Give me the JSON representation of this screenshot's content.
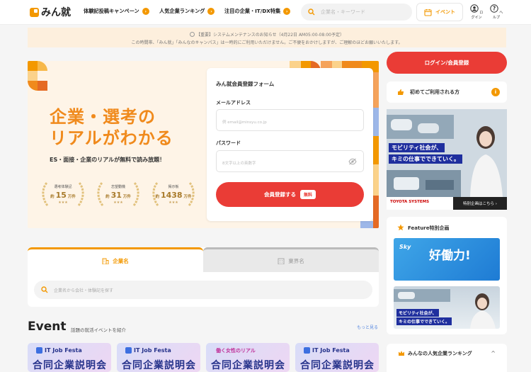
{
  "header": {
    "logo": "みん就",
    "nav": [
      {
        "label": "体験記投稿キャンペーン"
      },
      {
        "label": "人気企業ランキング"
      },
      {
        "label": "注目の企業・IT/DX特集"
      }
    ],
    "search_placeholder": "企業名・キーワード",
    "event_label": "イベント",
    "login_label": "ログイン",
    "help_label": "ヘルプ"
  },
  "notice": {
    "line1": "【重要】システムメンテナンスのお知らせ（4月22日 AM05:00-08:00予定）",
    "line2": "この時間帯、「みん就」「みんなのキャンパス」は一時的にご利用いただけません。ご不便をおかけしますが、ご理解のほどお願いいたします。"
  },
  "hero": {
    "title_line1": "企業・選考の",
    "title_line2": "リアルがわかる",
    "subtitle": "ES・面接・企業のリアルが無料で読み放題！",
    "badges": [
      {
        "label": "選考体験記",
        "prefix": "約",
        "value": "15",
        "unit": "万件",
        "stars": "★★★"
      },
      {
        "label": "志望動機",
        "prefix": "約",
        "value": "31",
        "unit": "万件",
        "stars": "★★★"
      },
      {
        "label": "掲示板",
        "prefix": "約",
        "value": "1438",
        "unit": "万件",
        "stars": "★★★"
      }
    ]
  },
  "form": {
    "title": "みん就会員登録フォーム",
    "email_label": "メールアドレス",
    "email_placeholder": "例 email@minsyu.co.jp",
    "password_label": "パスワード",
    "password_placeholder": "8文字以上の英数字",
    "submit_label": "会員登録する",
    "free_badge": "無料"
  },
  "search_tabs": {
    "tab_company": "企業名",
    "tab_industry": "業界名",
    "placeholder": "企業名から会社・体験記を探す"
  },
  "event_section": {
    "title": "Event",
    "subtitle": "話題の就活イベントを紹介",
    "more": "もっと見る",
    "cards": [
      {
        "top": "IT Job Festa",
        "main": "合同企業説明会"
      },
      {
        "top": "IT Job Festa",
        "main": "合同企業説明会"
      },
      {
        "top": "働く女性のリアル",
        "main": "合同企業説明会"
      },
      {
        "top": "IT Job Festa",
        "main": "合同企業説明会"
      }
    ]
  },
  "sidebar": {
    "login_button": "ログイン/会員登録",
    "first_time": "初めてご利用される方",
    "info_mark": "i",
    "ad": {
      "line1": "モビリティ社会が、",
      "line2": "キミの仕事でできていく。",
      "brand": "TOYOTA SYSTEMS",
      "special": "特別企画はこちら ›"
    },
    "feature": {
      "title": "Feature特別企画",
      "banner1_brand": "Sky",
      "banner1_text": "好働力!",
      "banner2_line1": "モビリティ社会が、",
      "banner2_line2": "キミの仕事でできていく。"
    },
    "ranking_title": "みんなの人気企業ランキング",
    "ranking_chevron": "^"
  },
  "colors": {
    "accent": "#f39800",
    "primary_red": "#ea3c36",
    "hero_bg": "#fef4e7",
    "notice_bg": "#fdefdd"
  }
}
